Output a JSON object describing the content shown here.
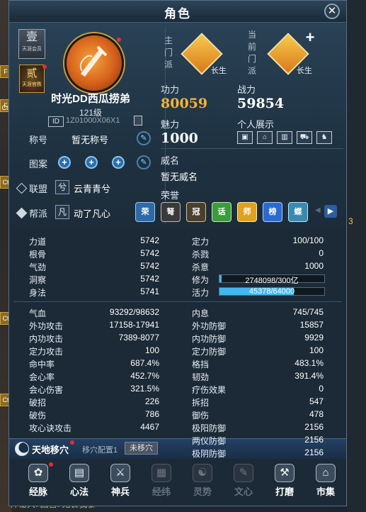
{
  "window": {
    "title": "角色",
    "close_label": "✕"
  },
  "background": {
    "left_tags": [
      "F",
      "F",
      "Ct",
      "Ct",
      "Ct",
      "Ct"
    ],
    "right_number": "3",
    "footer_text": "禅秘大: 国营: 无食我暴"
  },
  "profile": {
    "vip_badge": {
      "big": "壹",
      "small": "天涯会员"
    },
    "rank_badge": {
      "big": "贰",
      "small": "天涯官秩"
    },
    "name": "时光DD西瓜捞弟",
    "level": "121级",
    "id_label": "ID",
    "id_value": "1Z01000X06X1",
    "title_label": "称号",
    "title_value": "暂无称号",
    "pattern_label": "图案",
    "alliance_label": "联盟",
    "alliance_icon": "兮",
    "alliance_value": "云青青兮",
    "guild_label": "帮派",
    "guild_icon": "凡",
    "guild_value": "动了凡心"
  },
  "faction": {
    "main_label": "主门派",
    "main_name": "长生",
    "current_label": "当前门派",
    "current_name": "长生",
    "gongli_label": "功力",
    "gongli_value": "80059",
    "zhanli_label": "战力",
    "zhanli_value": "59854",
    "meili_label": "魅力",
    "meili_value": "1000",
    "display_label": "个人展示",
    "display_icons": [
      "card-icon",
      "house-icon",
      "building-icon",
      "vehicle-icon",
      "pet-icon"
    ],
    "weiming_label": "威名",
    "weiming_value": "暂无威名",
    "honor_label": "荣誉",
    "honors": [
      "荣",
      "弩",
      "冠",
      "话",
      "师",
      "榜",
      "蝶"
    ]
  },
  "stats_primary": {
    "left": [
      {
        "label": "力道",
        "value": "5742"
      },
      {
        "label": "根骨",
        "value": "5742"
      },
      {
        "label": "气劲",
        "value": "5742"
      },
      {
        "label": "洞察",
        "value": "5742"
      },
      {
        "label": "身法",
        "value": "5741"
      }
    ],
    "right": [
      {
        "label": "定力",
        "value": "100/100"
      },
      {
        "label": "杀戮",
        "value": "0"
      },
      {
        "label": "杀意",
        "value": "1000"
      }
    ],
    "xiuwei": {
      "label": "修为",
      "text": "2748098/300亿",
      "fraction": 0.0001
    },
    "huoli": {
      "label": "活力",
      "text": "45378/64000",
      "fraction": 0.709
    }
  },
  "stats_secondary": {
    "left": [
      {
        "label": "气血",
        "value": "93292/98632"
      },
      {
        "label": "外功攻击",
        "value": "17158-17941"
      },
      {
        "label": "内功攻击",
        "value": "7389-8077"
      },
      {
        "label": "定力攻击",
        "value": "100"
      },
      {
        "label": "命中率",
        "value": "687.4%"
      },
      {
        "label": "会心率",
        "value": "452.7%"
      },
      {
        "label": "会心伤害",
        "value": "321.5%"
      },
      {
        "label": "破招",
        "value": "226"
      },
      {
        "label": "破伤",
        "value": "786"
      },
      {
        "label": "攻心诀攻击",
        "value": "4467"
      }
    ],
    "right": [
      {
        "label": "内息",
        "value": "745/745"
      },
      {
        "label": "外功防御",
        "value": "15857"
      },
      {
        "label": "内功防御",
        "value": "9929"
      },
      {
        "label": "定力防御",
        "value": "100"
      },
      {
        "label": "格挡",
        "value": "483.1%"
      },
      {
        "label": "韧劲",
        "value": "391.4%"
      },
      {
        "label": "疗伤效果",
        "value": "0"
      },
      {
        "label": "拆招",
        "value": "547"
      },
      {
        "label": "御伤",
        "value": "478"
      },
      {
        "label": "极阳防御",
        "value": "2156"
      },
      {
        "label": "两仪防御",
        "value": "2156"
      },
      {
        "label": "极阴防御",
        "value": "2156"
      }
    ]
  },
  "acupoint": {
    "title": "天地移穴",
    "config": "移穴配置1",
    "button": "未移穴"
  },
  "tabs": [
    {
      "label": "经脉",
      "icon": "✿",
      "active": true
    },
    {
      "label": "心法",
      "icon": "▤",
      "active": true
    },
    {
      "label": "神兵",
      "icon": "⚔",
      "active": true
    },
    {
      "label": "经纬",
      "icon": "▦",
      "active": false
    },
    {
      "label": "灵势",
      "icon": "☯",
      "active": false
    },
    {
      "label": "文心",
      "icon": "✎",
      "active": false
    },
    {
      "label": "打磨",
      "icon": "⚒",
      "active": true
    },
    {
      "label": "市集",
      "icon": "⌂",
      "active": true
    }
  ],
  "colors": {
    "gongli": "#f7b23a",
    "accent_bar": "#3fb8f0"
  }
}
